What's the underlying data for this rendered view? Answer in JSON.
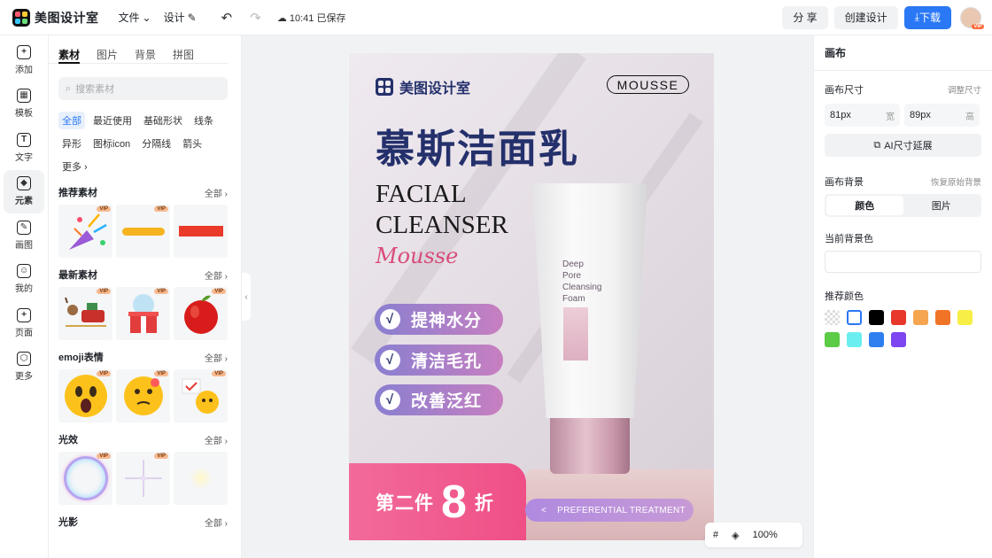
{
  "topbar": {
    "logo_text": "美图设计室",
    "menu_file": "文件",
    "menu_design": "设计",
    "save_status": "10:41 已保存",
    "share": "分 享",
    "create": "创建设计",
    "download": "下载",
    "avatar_badge": "VIP"
  },
  "rail": [
    {
      "label": "添加",
      "icon": "plus-icon",
      "glyph": "+"
    },
    {
      "label": "模板",
      "icon": "template-icon",
      "glyph": "▦"
    },
    {
      "label": "文字",
      "icon": "text-icon",
      "glyph": "T"
    },
    {
      "label": "元素",
      "icon": "element-icon",
      "glyph": "◆"
    },
    {
      "label": "画图",
      "icon": "draw-icon",
      "glyph": "✎"
    },
    {
      "label": "我的",
      "icon": "user-icon",
      "glyph": "☺"
    },
    {
      "label": "页面",
      "icon": "page-icon",
      "glyph": "+"
    },
    {
      "label": "更多",
      "icon": "more-icon",
      "glyph": "⬡"
    }
  ],
  "panel": {
    "tabs": [
      "素材",
      "图片",
      "背景",
      "拼图"
    ],
    "search_placeholder": "搜索素材",
    "chips": [
      "全部",
      "最近使用",
      "基础形状",
      "线条",
      "异形",
      "图标icon",
      "分隔线",
      "箭头",
      "更多 ›"
    ],
    "sections": [
      {
        "title": "推荐素材",
        "all": "全部 ›"
      },
      {
        "title": "最新素材",
        "all": "全部 ›"
      },
      {
        "title": "emoji表情",
        "all": "全部 ›"
      },
      {
        "title": "光效",
        "all": "全部 ›"
      },
      {
        "title": "光影",
        "all": "全部 ›"
      }
    ],
    "vip": "VIP"
  },
  "poster": {
    "brand": "美图设计室",
    "badge": "MOUSSE",
    "title": "慕斯洁面乳",
    "en_line1": "FACIAL",
    "en_line2": "CLEANSER",
    "script": "Mousse",
    "pills": [
      "提神水分",
      "清洁毛孔",
      "改善泛红"
    ],
    "check": "√",
    "tube_text": "Deep\nPore\nCleansing\nFoam",
    "band_prefix": "第二件",
    "band_number": "8",
    "band_suffix": "折",
    "pref_arrow": "<",
    "pref_text": "PREFERENTIAL TREATMENT"
  },
  "zoom": {
    "value": "100%"
  },
  "right": {
    "title": "画布",
    "size_label": "画布尺寸",
    "size_action": "调整尺寸",
    "width_value": "81px",
    "width_unit": "宽",
    "height_value": "89px",
    "height_unit": "高",
    "ai_extend": "AI尺寸延展",
    "bg_label": "画布背景",
    "bg_reset": "恢复原始背景",
    "seg_color": "颜色",
    "seg_image": "图片",
    "current_bg": "当前背景色",
    "recommend": "推荐颜色",
    "swatches": [
      "transparent",
      "#ffffff",
      "#000000",
      "#e8382b",
      "#f5a550",
      "#f07428",
      "#f8ef46",
      "#5ccb45",
      "#6beef0",
      "#2f7ff0",
      "#7d46f0"
    ]
  }
}
